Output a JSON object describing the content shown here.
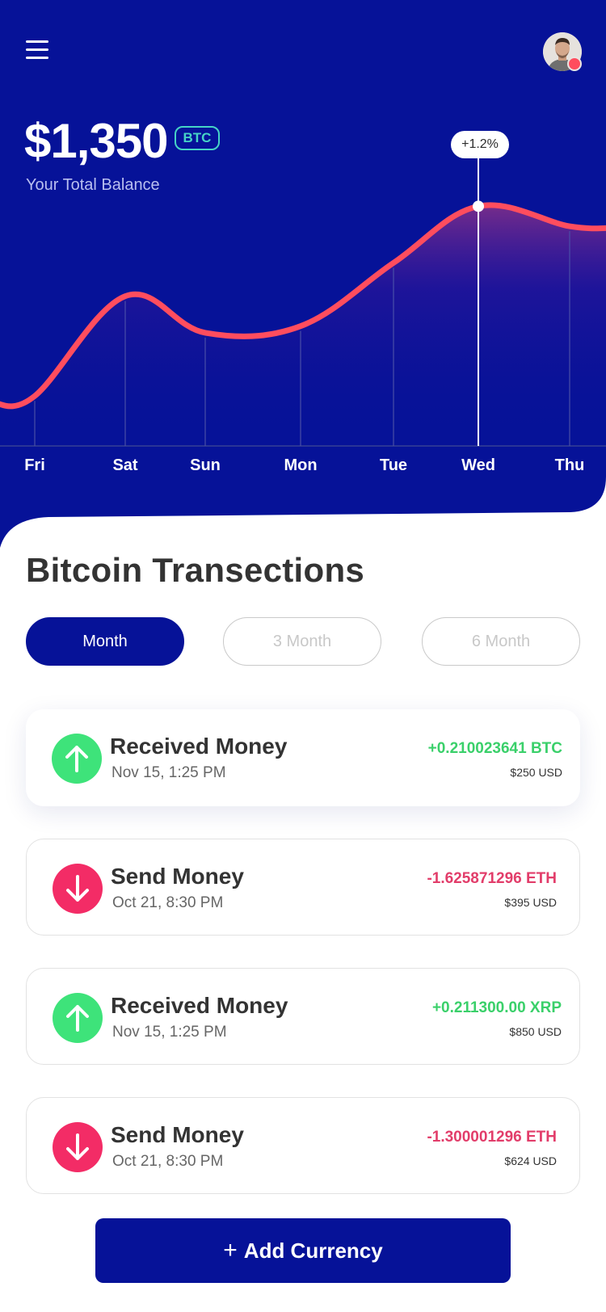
{
  "header": {
    "balance": "$1,350",
    "currency_badge": "BTC",
    "balance_label": "Your Total Balance",
    "tooltip": "+1.2%",
    "menu_icon": "menu-icon",
    "avatar_icon": "user-avatar"
  },
  "chart_data": {
    "type": "line",
    "categories": [
      "Fri",
      "Sat",
      "Sun",
      "Mon",
      "Tue",
      "Wed",
      "Thu"
    ],
    "series": [
      {
        "values": [
          0.15,
          0.45,
          0.34,
          0.36,
          0.55,
          0.72,
          0.66
        ]
      }
    ],
    "highlight": {
      "category": "Wed",
      "label": "+1.2%"
    },
    "ylim": [
      0,
      1
    ],
    "grid": true,
    "colors": {
      "line": "#ff4d5e",
      "background": "#061298"
    }
  },
  "transactions": {
    "title": "Bitcoin Transections",
    "filters": [
      {
        "label": "Month",
        "active": true
      },
      {
        "label": "3 Month",
        "active": false
      },
      {
        "label": "6 Month",
        "active": false
      }
    ],
    "items": [
      {
        "type": "received",
        "title": "Received Money",
        "date": "Nov 15, 1:25 PM",
        "amount": "+0.210023641 BTC",
        "usd": "$250 USD",
        "icon": "arrow-up-icon"
      },
      {
        "type": "sent",
        "title": "Send Money",
        "date": "Oct 21, 8:30 PM",
        "amount": "-1.625871296 ETH",
        "usd": "$395 USD",
        "icon": "arrow-down-icon"
      },
      {
        "type": "received",
        "title": "Received Money",
        "date": "Nov 15, 1:25 PM",
        "amount": "+0.211300.00 XRP",
        "usd": "$850 USD",
        "icon": "arrow-up-icon"
      },
      {
        "type": "sent",
        "title": "Send Money",
        "date": "Oct 21, 8:30 PM",
        "amount": "-1.300001296 ETH",
        "usd": "$624 USD",
        "icon": "arrow-down-icon"
      }
    ]
  },
  "actions": {
    "add_currency": "Add Currency",
    "add_icon": "plus-icon"
  },
  "colors": {
    "primary": "#061298",
    "accent_line": "#ff4d5e",
    "positive": "#3ad06a",
    "negative": "#e23d6a",
    "badge": "#46d3c6"
  }
}
